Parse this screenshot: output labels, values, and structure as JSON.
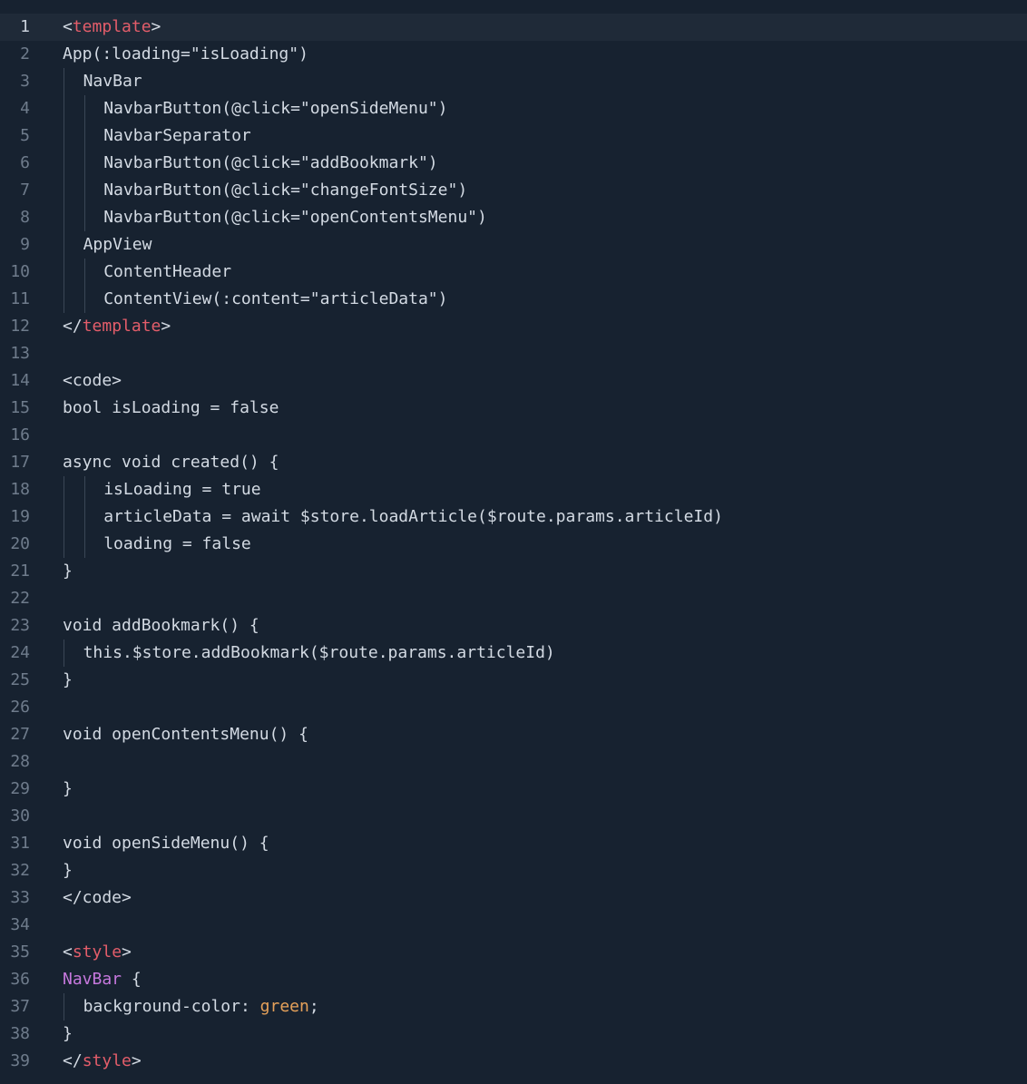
{
  "editor": {
    "language": "vue-like template",
    "colors": {
      "background": "#172230",
      "active_line": "#1f2a38",
      "text": "#d3dae3",
      "line_number": "#6f7c8c",
      "tag": "#e35d6a",
      "selector": "#c678dd",
      "value": "#e5a15a",
      "indent_guide": "#3a4656"
    },
    "lines": [
      {
        "n": "1",
        "indent": 0,
        "guides": 0,
        "tokens": [
          {
            "t": "<"
          },
          {
            "t": "template",
            "c": "tag"
          },
          {
            "t": ">"
          }
        ]
      },
      {
        "n": "2",
        "indent": 0,
        "guides": 0,
        "tokens": [
          {
            "t": "App(:loading=\"isLoading\")"
          }
        ]
      },
      {
        "n": "3",
        "indent": 1,
        "guides": 1,
        "tokens": [
          {
            "t": "NavBar"
          }
        ]
      },
      {
        "n": "4",
        "indent": 2,
        "guides": 2,
        "tokens": [
          {
            "t": "NavbarButton(@click=\"openSideMenu\")"
          }
        ]
      },
      {
        "n": "5",
        "indent": 2,
        "guides": 2,
        "tokens": [
          {
            "t": "NavbarSeparator"
          }
        ]
      },
      {
        "n": "6",
        "indent": 2,
        "guides": 2,
        "tokens": [
          {
            "t": "NavbarButton(@click=\"addBookmark\")"
          }
        ]
      },
      {
        "n": "7",
        "indent": 2,
        "guides": 2,
        "tokens": [
          {
            "t": "NavbarButton(@click=\"changeFontSize\")"
          }
        ]
      },
      {
        "n": "8",
        "indent": 2,
        "guides": 2,
        "tokens": [
          {
            "t": "NavbarButton(@click=\"openContentsMenu\")"
          }
        ]
      },
      {
        "n": "9",
        "indent": 1,
        "guides": 1,
        "tokens": [
          {
            "t": "AppView"
          }
        ]
      },
      {
        "n": "10",
        "indent": 2,
        "guides": 2,
        "tokens": [
          {
            "t": "ContentHeader"
          }
        ]
      },
      {
        "n": "11",
        "indent": 2,
        "guides": 2,
        "tokens": [
          {
            "t": "ContentView(:content=\"articleData\")"
          }
        ]
      },
      {
        "n": "12",
        "indent": 0,
        "guides": 0,
        "tokens": [
          {
            "t": "</"
          },
          {
            "t": "template",
            "c": "tag"
          },
          {
            "t": ">"
          }
        ]
      },
      {
        "n": "13",
        "indent": 0,
        "guides": 0,
        "tokens": []
      },
      {
        "n": "14",
        "indent": 0,
        "guides": 0,
        "tokens": [
          {
            "t": "<code>"
          }
        ]
      },
      {
        "n": "15",
        "indent": 0,
        "guides": 0,
        "tokens": [
          {
            "t": "bool isLoading = false"
          }
        ]
      },
      {
        "n": "16",
        "indent": 0,
        "guides": 0,
        "tokens": []
      },
      {
        "n": "17",
        "indent": 0,
        "guides": 0,
        "tokens": [
          {
            "t": "async void created() {"
          }
        ]
      },
      {
        "n": "18",
        "indent": 2,
        "guides": 2,
        "tokens": [
          {
            "t": "isLoading = true"
          }
        ]
      },
      {
        "n": "19",
        "indent": 2,
        "guides": 2,
        "tokens": [
          {
            "t": "articleData = await $store.loadArticle($route.params.articleId)"
          }
        ]
      },
      {
        "n": "20",
        "indent": 2,
        "guides": 2,
        "tokens": [
          {
            "t": "loading = false"
          }
        ]
      },
      {
        "n": "21",
        "indent": 0,
        "guides": 0,
        "tokens": [
          {
            "t": "}"
          }
        ]
      },
      {
        "n": "22",
        "indent": 0,
        "guides": 0,
        "tokens": []
      },
      {
        "n": "23",
        "indent": 0,
        "guides": 0,
        "tokens": [
          {
            "t": "void addBookmark() {"
          }
        ]
      },
      {
        "n": "24",
        "indent": 1,
        "guides": 1,
        "tokens": [
          {
            "t": "this.$store.addBookmark($route.params.articleId)"
          }
        ]
      },
      {
        "n": "25",
        "indent": 0,
        "guides": 0,
        "tokens": [
          {
            "t": "}"
          }
        ]
      },
      {
        "n": "26",
        "indent": 0,
        "guides": 0,
        "tokens": []
      },
      {
        "n": "27",
        "indent": 0,
        "guides": 0,
        "tokens": [
          {
            "t": "void openContentsMenu() {"
          }
        ]
      },
      {
        "n": "28",
        "indent": 0,
        "guides": 0,
        "tokens": []
      },
      {
        "n": "29",
        "indent": 0,
        "guides": 0,
        "tokens": [
          {
            "t": "}"
          }
        ]
      },
      {
        "n": "30",
        "indent": 0,
        "guides": 0,
        "tokens": []
      },
      {
        "n": "31",
        "indent": 0,
        "guides": 0,
        "tokens": [
          {
            "t": "void openSideMenu() {"
          }
        ]
      },
      {
        "n": "32",
        "indent": 0,
        "guides": 0,
        "tokens": [
          {
            "t": "}"
          }
        ]
      },
      {
        "n": "33",
        "indent": 0,
        "guides": 0,
        "tokens": [
          {
            "t": "</code>"
          }
        ]
      },
      {
        "n": "34",
        "indent": 0,
        "guides": 0,
        "tokens": []
      },
      {
        "n": "35",
        "indent": 0,
        "guides": 0,
        "tokens": [
          {
            "t": "<"
          },
          {
            "t": "style",
            "c": "tag"
          },
          {
            "t": ">"
          }
        ]
      },
      {
        "n": "36",
        "indent": 0,
        "guides": 0,
        "tokens": [
          {
            "t": "NavBar",
            "c": "selector"
          },
          {
            "t": " {"
          }
        ]
      },
      {
        "n": "37",
        "indent": 1,
        "guides": 1,
        "tokens": [
          {
            "t": "background-color: "
          },
          {
            "t": "green",
            "c": "value"
          },
          {
            "t": ";"
          }
        ]
      },
      {
        "n": "38",
        "indent": 0,
        "guides": 0,
        "tokens": [
          {
            "t": "}"
          }
        ]
      },
      {
        "n": "39",
        "indent": 0,
        "guides": 0,
        "tokens": [
          {
            "t": "</"
          },
          {
            "t": "style",
            "c": "tag"
          },
          {
            "t": ">"
          }
        ]
      }
    ],
    "active_line": "1"
  }
}
